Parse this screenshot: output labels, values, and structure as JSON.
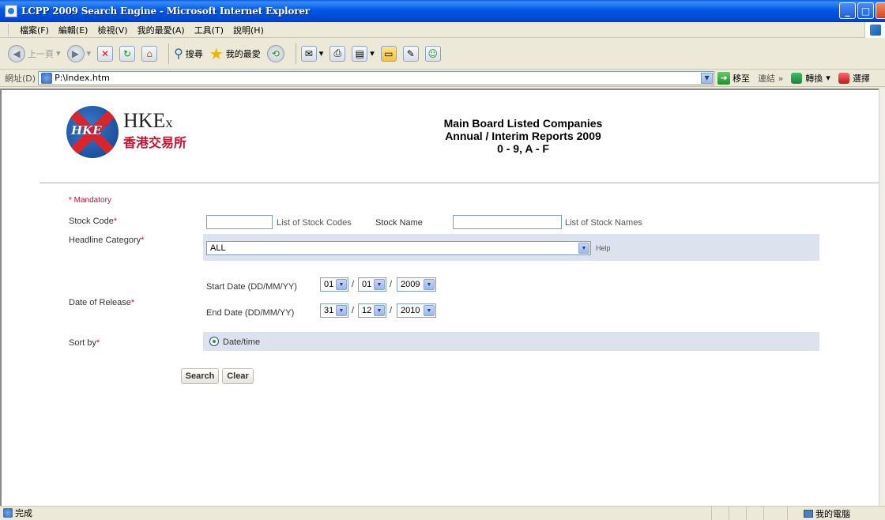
{
  "window": {
    "title": "LCPP 2009 Search Engine - Microsoft Internet Explorer",
    "minimize": "_",
    "maximize": "□"
  },
  "menu": [
    "檔案(F)",
    "編輯(E)",
    "檢視(V)",
    "我的最愛(A)",
    "工具(T)",
    "說明(H)"
  ],
  "toolbar": {
    "back": "上一頁",
    "search": "搜尋",
    "favorites": "我的最愛"
  },
  "address": {
    "label": "網址(D)",
    "value": "P:\\Index.htm",
    "go": "移至",
    "links": "連結",
    "links_more": "»",
    "convert": "轉換",
    "select": "選擇"
  },
  "page": {
    "title_line1": "Main Board Listed Companies",
    "title_line2": "Annual / Interim Reports 2009",
    "title_line3": "0 - 9, A - F",
    "logo": {
      "mark": "HKE",
      "word_main": "HKE",
      "word_small": "x",
      "chinese": "香港交易所"
    }
  },
  "form": {
    "mandatory_note": "* Mandatory",
    "stock_code_label": "Stock Code",
    "list_stock_codes": "List of Stock Codes",
    "stock_name_label": "Stock Name",
    "list_stock_names": "List of Stock Names",
    "headline_label": "Headline Category",
    "headline_value": "ALL",
    "help": "Help",
    "date_label": "Date of Release",
    "start_label": "Start Date (DD/MM/YY)",
    "end_label": "End Date (DD/MM/YY)",
    "start": {
      "dd": "01",
      "mm": "01",
      "yy": "2009"
    },
    "end": {
      "dd": "31",
      "mm": "12",
      "yy": "2010"
    },
    "sort_label": "Sort by",
    "sort_option": "Date/time",
    "search_btn": "Search",
    "clear_btn": "Clear",
    "asterisk": "*",
    "slash": "/"
  },
  "status": {
    "text": "完成",
    "zone": "我的電腦"
  },
  "colors": {
    "titlebar": "#0058e6",
    "band": "#dde3ee",
    "required": "#c8102e"
  }
}
